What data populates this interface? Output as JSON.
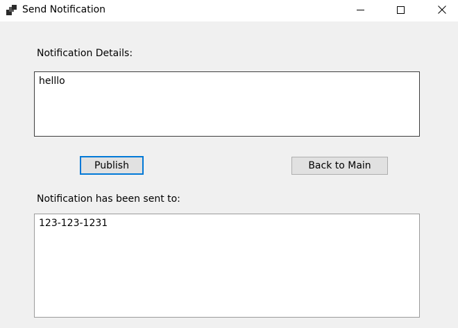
{
  "window": {
    "title": "Send Notification",
    "app_icon": "windows-form-icon",
    "controls": {
      "minimize_icon": "minimize-icon",
      "maximize_icon": "maximize-icon",
      "close_icon": "close-icon"
    }
  },
  "form": {
    "details_label": "Notification Details:",
    "details_value": "helllo",
    "publish_label": "Publish",
    "back_label": "Back to Main",
    "sent_label": "Notification has been sent to:",
    "sent_value": "123-123-1231"
  },
  "colors": {
    "window_background": "#f0f0f0",
    "titlebar_background": "#ffffff",
    "focus_accent": "#0078d7",
    "button_background": "#e1e1e1"
  }
}
